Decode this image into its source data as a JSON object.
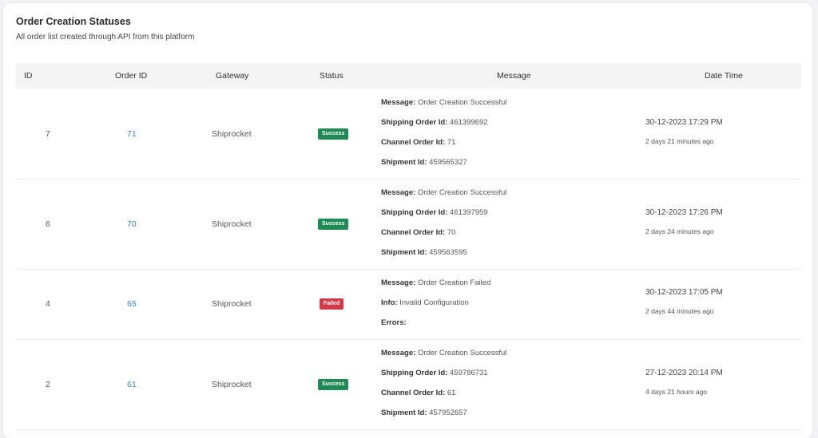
{
  "card": {
    "title": "Order Creation Statuses",
    "subtitle": "All order list created through API from this platform"
  },
  "table": {
    "headers": {
      "id": "ID",
      "order_id": "Order ID",
      "gateway": "Gateway",
      "status": "Status",
      "message": "Message",
      "date_time": "Date Time"
    },
    "rows": [
      {
        "id": "7",
        "order_id": "71",
        "gateway": "Shiprocket",
        "status": "Success",
        "lines": [
          {
            "label": "Message:",
            "value": "Order Creation Successful"
          },
          {
            "label": "Shipping Order Id:",
            "value": "461399692"
          },
          {
            "label": "Channel Order Id:",
            "value": "71"
          },
          {
            "label": "Shipment Id:",
            "value": "459565327"
          }
        ],
        "date": "30-12-2023 17:29 PM",
        "ago": "2 days 21 minutes ago"
      },
      {
        "id": "6",
        "order_id": "70",
        "gateway": "Shiprocket",
        "status": "Success",
        "lines": [
          {
            "label": "Message:",
            "value": "Order Creation Successful"
          },
          {
            "label": "Shipping Order Id:",
            "value": "461397959"
          },
          {
            "label": "Channel Order Id:",
            "value": "70"
          },
          {
            "label": "Shipment Id:",
            "value": "459563595"
          }
        ],
        "date": "30-12-2023 17:26 PM",
        "ago": "2 days 24 minutes ago"
      },
      {
        "id": "4",
        "order_id": "65",
        "gateway": "Shiprocket",
        "status": "Failed",
        "lines": [
          {
            "label": "Message:",
            "value": "Order Creation Failed"
          },
          {
            "label": "Info:",
            "value": "Invalid Configuration"
          },
          {
            "label": "Errors:",
            "value": ""
          }
        ],
        "date": "30-12-2023 17:05 PM",
        "ago": "2 days 44 minutes ago"
      },
      {
        "id": "2",
        "order_id": "61",
        "gateway": "Shiprocket",
        "status": "Success",
        "lines": [
          {
            "label": "Message:",
            "value": "Order Creation Successful"
          },
          {
            "label": "Shipping Order Id:",
            "value": "459786731"
          },
          {
            "label": "Channel Order Id:",
            "value": "61"
          },
          {
            "label": "Shipment Id:",
            "value": "457952657"
          }
        ],
        "date": "27-12-2023 20:14 PM",
        "ago": "4 days 21 hours ago"
      }
    ]
  },
  "colors": {
    "success": "#1f8a55",
    "failed": "#d33a49",
    "link": "#3b82c4"
  }
}
